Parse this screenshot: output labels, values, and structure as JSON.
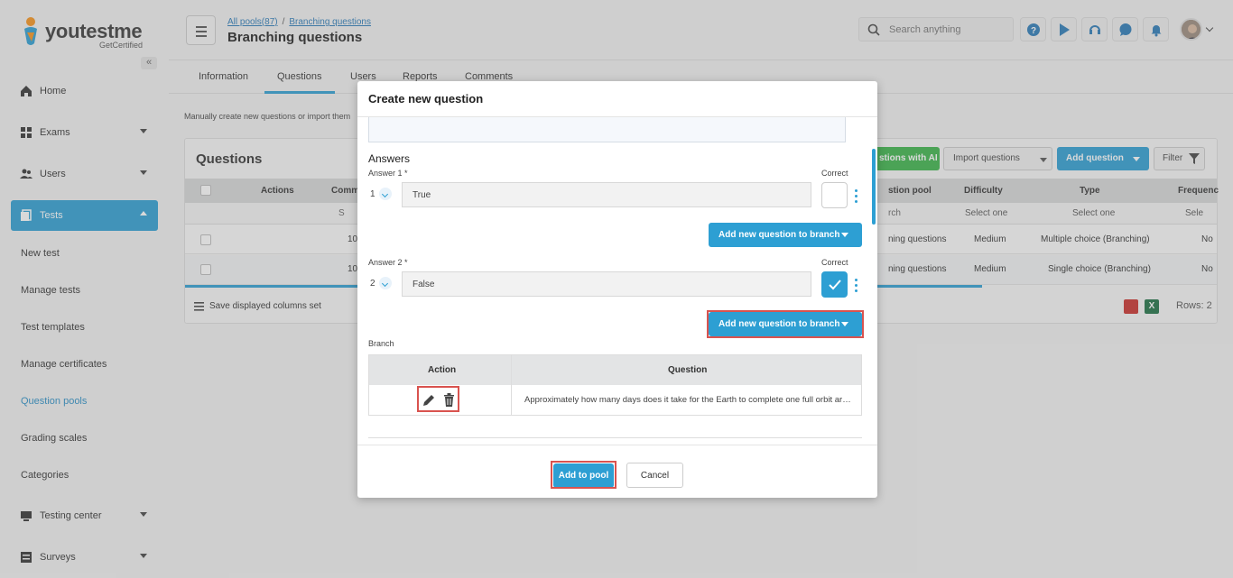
{
  "app": {
    "logo_text": "youtestme",
    "logo_sub": "GetCertified"
  },
  "sidebar": {
    "nav": [
      {
        "label": "Home",
        "icon": "home-icon"
      },
      {
        "label": "Exams",
        "icon": "exams-icon"
      },
      {
        "label": "Users",
        "icon": "users-icon"
      },
      {
        "label": "Tests",
        "icon": "tests-icon"
      }
    ],
    "tests_sub": [
      "New test",
      "Manage tests",
      "Test templates",
      "Manage certificates",
      "Question pools",
      "Grading scales",
      "Categories"
    ],
    "nav_bottom": [
      {
        "label": "Testing center",
        "icon": "testing-center-icon"
      },
      {
        "label": "Surveys",
        "icon": "surveys-icon"
      }
    ]
  },
  "header": {
    "breadcrumb": [
      "All pools(87)",
      "Branching questions"
    ],
    "title": "Branching questions",
    "search_placeholder": "Search anything"
  },
  "tabs": [
    "Information",
    "Questions",
    "Users",
    "Reports",
    "Comments"
  ],
  "page": {
    "intro": "Manually create new questions or import them",
    "panel_title": "Questions",
    "btn_ai": "stions with AI",
    "btn_import": "Import questions",
    "btn_add": "Add question",
    "btn_filter": "Filter",
    "columns": [
      "Actions",
      "Comm",
      "stion pool",
      "Difficulty",
      "Type",
      "Frequenc"
    ],
    "filter_search": "S",
    "filter_pool": "rch",
    "filter_difficulty": "Select one",
    "filter_type": "Select one",
    "filter_freq": "Sele",
    "rows": [
      {
        "comm": "10",
        "pool": "ning questions",
        "difficulty": "Medium",
        "type": "Multiple choice (Branching)",
        "freq": "No"
      },
      {
        "comm": "10",
        "pool": "ning questions",
        "difficulty": "Medium",
        "type": "Single choice (Branching)",
        "freq": "No"
      }
    ],
    "save_cols": "Save displayed columns set",
    "rows_count": "Rows: 2",
    "xls_label": "X"
  },
  "modal": {
    "title": "Create new question",
    "answers_heading": "Answers",
    "answer1_label": "Answer 1 *",
    "answer2_label": "Answer 2 *",
    "correct_label": "Correct",
    "answer1_num": "1",
    "answer2_num": "2",
    "answer1_value": "True",
    "answer2_value": "False",
    "add_branch_label": "Add new question to branch",
    "branch_label": "Branch",
    "branch_columns": [
      "Action",
      "Question"
    ],
    "branch_question": "Approximately how many days does it take for the Earth to complete one full orbit around the Sun?",
    "add_to_pool": "Add to pool",
    "cancel": "Cancel"
  },
  "colors": {
    "accent": "#2d9fd3",
    "highlight": "#d9534f",
    "ai_green": "#3bb54a"
  }
}
